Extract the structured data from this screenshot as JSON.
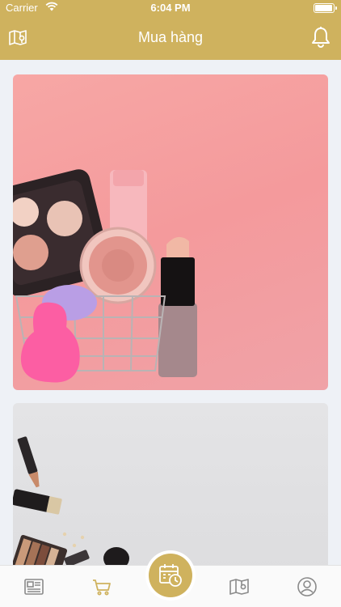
{
  "status_bar": {
    "carrier": "Carrier",
    "time": "6:04 PM"
  },
  "header": {
    "title": "Mua hàng",
    "left_icon": "map-icon",
    "right_icon": "bell-icon"
  },
  "feed": {
    "cards": [
      {
        "image": "cosmetics-basket-pink"
      },
      {
        "image": "makeup-products-grey"
      }
    ]
  },
  "tab_bar": {
    "items": [
      {
        "icon": "newspaper-icon",
        "active": false
      },
      {
        "icon": "cart-icon",
        "active": true
      },
      {
        "icon": "calendar-clock-icon",
        "active": false,
        "center": true
      },
      {
        "icon": "map-icon",
        "active": false
      },
      {
        "icon": "user-icon",
        "active": false
      }
    ]
  },
  "colors": {
    "brand": "#cfb25e",
    "background": "#eef1f6",
    "tab_inactive": "#8a8a8a"
  }
}
